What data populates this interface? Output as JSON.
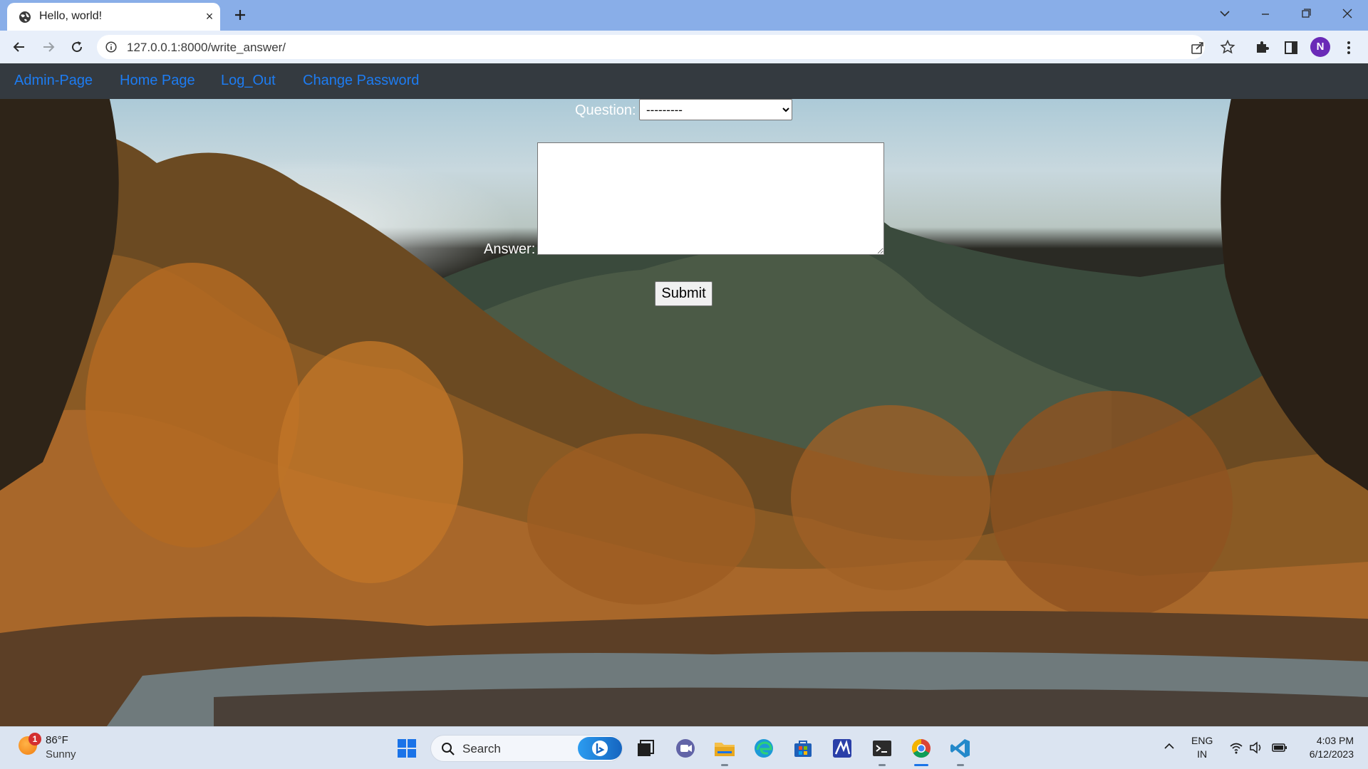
{
  "browser": {
    "tab_title": "Hello, world!",
    "tab_close_glyph": "×",
    "url": "127.0.0.1:8000/write_answer/",
    "profile_initial": "N",
    "icons": [
      "globe-icon",
      "plus-icon",
      "chevron-down-icon",
      "minimize-icon",
      "restore-icon",
      "close-icon",
      "back-arrow-icon",
      "forward-arrow-icon",
      "reload-icon",
      "info-icon",
      "share-icon",
      "star-icon",
      "puzzle-icon",
      "side-panel-icon",
      "kebab-menu-icon"
    ]
  },
  "site_nav": {
    "links": [
      "Admin-Page",
      "Home Page",
      "Log_Out",
      "Change Password"
    ],
    "link_color": "#1d7cf2",
    "bar_color": "#343a40"
  },
  "form": {
    "question_label": "Question:",
    "question_selected": "---------",
    "answer_label": "Answer:",
    "answer_value": "",
    "submit_label": "Submit"
  },
  "taskbar": {
    "weather": {
      "badge": "1",
      "temp": "86°F",
      "condition": "Sunny"
    },
    "search_label": "Search",
    "apps": [
      "windows-start-icon",
      "bing-icon",
      "task-view-icon",
      "teams-icon",
      "file-explorer-icon",
      "edge-icon",
      "microsoft-store-icon",
      "app-icon",
      "terminal-icon",
      "chrome-icon",
      "vscode-icon"
    ],
    "language": {
      "line1": "ENG",
      "line2": "IN"
    },
    "clock": {
      "time": "4:03 PM",
      "date": "6/12/2023"
    }
  }
}
